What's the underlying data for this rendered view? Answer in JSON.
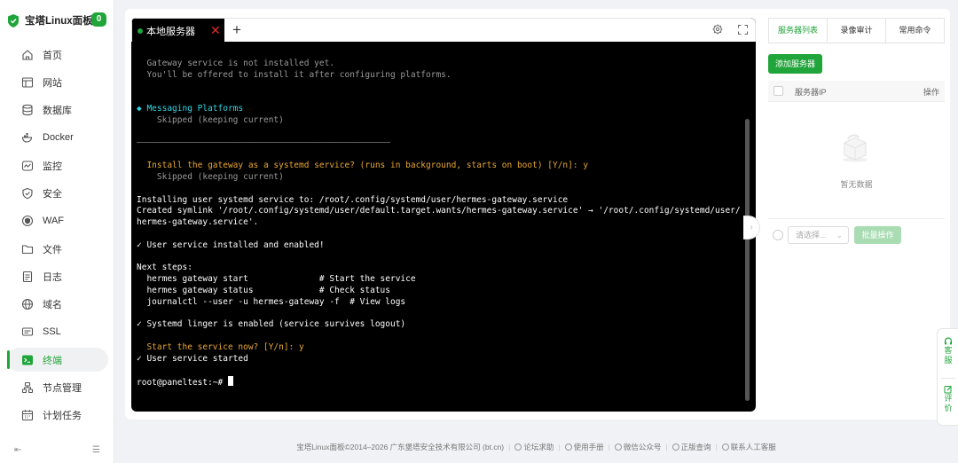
{
  "brand": {
    "title": "宝塔Linux面板",
    "badge": "0",
    "accent": "#20a53a"
  },
  "nav": [
    {
      "label": "首页",
      "icon": "home-icon"
    },
    {
      "label": "网站",
      "icon": "website-icon"
    },
    {
      "label": "数据库",
      "icon": "database-icon"
    },
    {
      "label": "Docker",
      "icon": "docker-icon"
    },
    {
      "label": "监控",
      "icon": "monitor-icon"
    },
    {
      "label": "安全",
      "icon": "shield-icon"
    },
    {
      "label": "WAF",
      "icon": "waf-icon"
    },
    {
      "label": "文件",
      "icon": "folder-icon"
    },
    {
      "label": "日志",
      "icon": "log-icon"
    },
    {
      "label": "域名",
      "icon": "globe-icon"
    },
    {
      "label": "SSL",
      "icon": "ssl-icon"
    },
    {
      "label": "终端",
      "icon": "terminal-icon",
      "active": true
    },
    {
      "label": "节点管理",
      "icon": "node-icon"
    },
    {
      "label": "计划任务",
      "icon": "calendar-icon"
    }
  ],
  "terminal": {
    "tab_label": "本地服务器",
    "lines": [
      {
        "t": "  Gateway service is not installed yet.",
        "c": "dim"
      },
      {
        "t": "  You'll be offered to install it after configuring platforms.",
        "c": "dim"
      },
      {
        "t": "",
        "c": ""
      },
      {
        "t": "",
        "c": ""
      },
      {
        "t": "◆ Messaging Platforms",
        "c": "cyan"
      },
      {
        "t": "    Skipped (keeping current)",
        "c": "dim"
      },
      {
        "t": "",
        "c": ""
      },
      {
        "t": "──────────────────────────────────────────────────",
        "c": "rule"
      },
      {
        "t": "",
        "c": ""
      },
      {
        "t": "  Install the gateway as a systemd service? (runs in background, starts on boot) [Y/n]: y",
        "c": "yel"
      },
      {
        "t": "    Skipped (keeping current)",
        "c": "dim"
      },
      {
        "t": "",
        "c": ""
      },
      {
        "t": "Installing user systemd service to: /root/.config/systemd/user/hermes-gateway.service",
        "c": ""
      },
      {
        "t": "Created symlink '/root/.config/systemd/user/default.target.wants/hermes-gateway.service' → '/root/.config/systemd/user/",
        "c": ""
      },
      {
        "t": "hermes-gateway.service'.",
        "c": ""
      },
      {
        "t": "",
        "c": ""
      },
      {
        "t": "✓ User service installed and enabled!",
        "c": ""
      },
      {
        "t": "",
        "c": ""
      },
      {
        "t": "Next steps:",
        "c": ""
      },
      {
        "t": "  hermes gateway start              # Start the service",
        "c": ""
      },
      {
        "t": "  hermes gateway status             # Check status",
        "c": ""
      },
      {
        "t": "  journalctl --user -u hermes-gateway -f  # View logs",
        "c": ""
      },
      {
        "t": "",
        "c": ""
      },
      {
        "t": "✓ Systemd linger is enabled (service survives logout)",
        "c": ""
      },
      {
        "t": "",
        "c": ""
      },
      {
        "t": "  Start the service now? [Y/n]: y",
        "c": "yel"
      },
      {
        "t": "✓ User service started",
        "c": ""
      },
      {
        "t": "",
        "c": ""
      },
      {
        "t": "root@paneltest:~# ",
        "c": "",
        "cursor": true
      }
    ]
  },
  "right_panel": {
    "tabs": [
      "服务器列表",
      "录像审计",
      "常用命令"
    ],
    "add_button": "添加服务器",
    "col_ip": "服务器IP",
    "col_action": "操作",
    "empty_text": "暂无数据",
    "select_placeholder": "请选择...",
    "batch_button": "批量操作"
  },
  "float": {
    "service": "客服",
    "review": "评价"
  },
  "footer": {
    "copyright": "宝塔Linux面板©2014–2026 广东堡塔安全技术有限公司 (bt.cn)",
    "links": [
      "论坛求助",
      "使用手册",
      "微信公众号",
      "正版查询",
      "联系人工客服"
    ]
  }
}
